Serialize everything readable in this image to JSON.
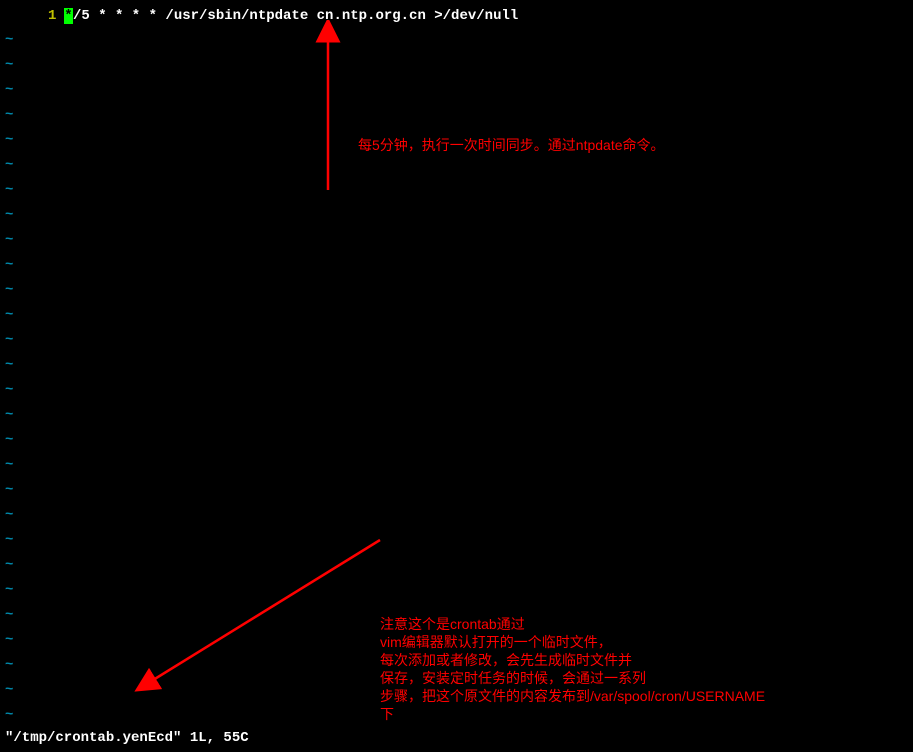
{
  "editor": {
    "line_number": "1",
    "cursor_char": "*",
    "code_content": "/5 * * * * /usr/sbin/ntpdate cn.ntp.org.cn >/dev/null",
    "tilde_char": "~",
    "status_bar": "\"/tmp/crontab.yenEcd\" 1L, 55C"
  },
  "annotations": {
    "top_note": "每5分钟，执行一次时间同步。通过ntpdate命令。",
    "bottom_note": "注意这个是crontab通过\nvim编辑器默认打开的一个临时文件，\n每次添加或者修改，会先生成临时文件并\n保存，安装定时任务的时候，会通过一系列\n步骤，把这个原文件的内容发布到/var/spool/cron/USERNAME\n下"
  },
  "tilde_positions": [
    32,
    57,
    82,
    107,
    132,
    157,
    182,
    207,
    232,
    257,
    282,
    307,
    332,
    357,
    382,
    407,
    432,
    457,
    482,
    507,
    532,
    557,
    582,
    607,
    632,
    657,
    682,
    707
  ]
}
